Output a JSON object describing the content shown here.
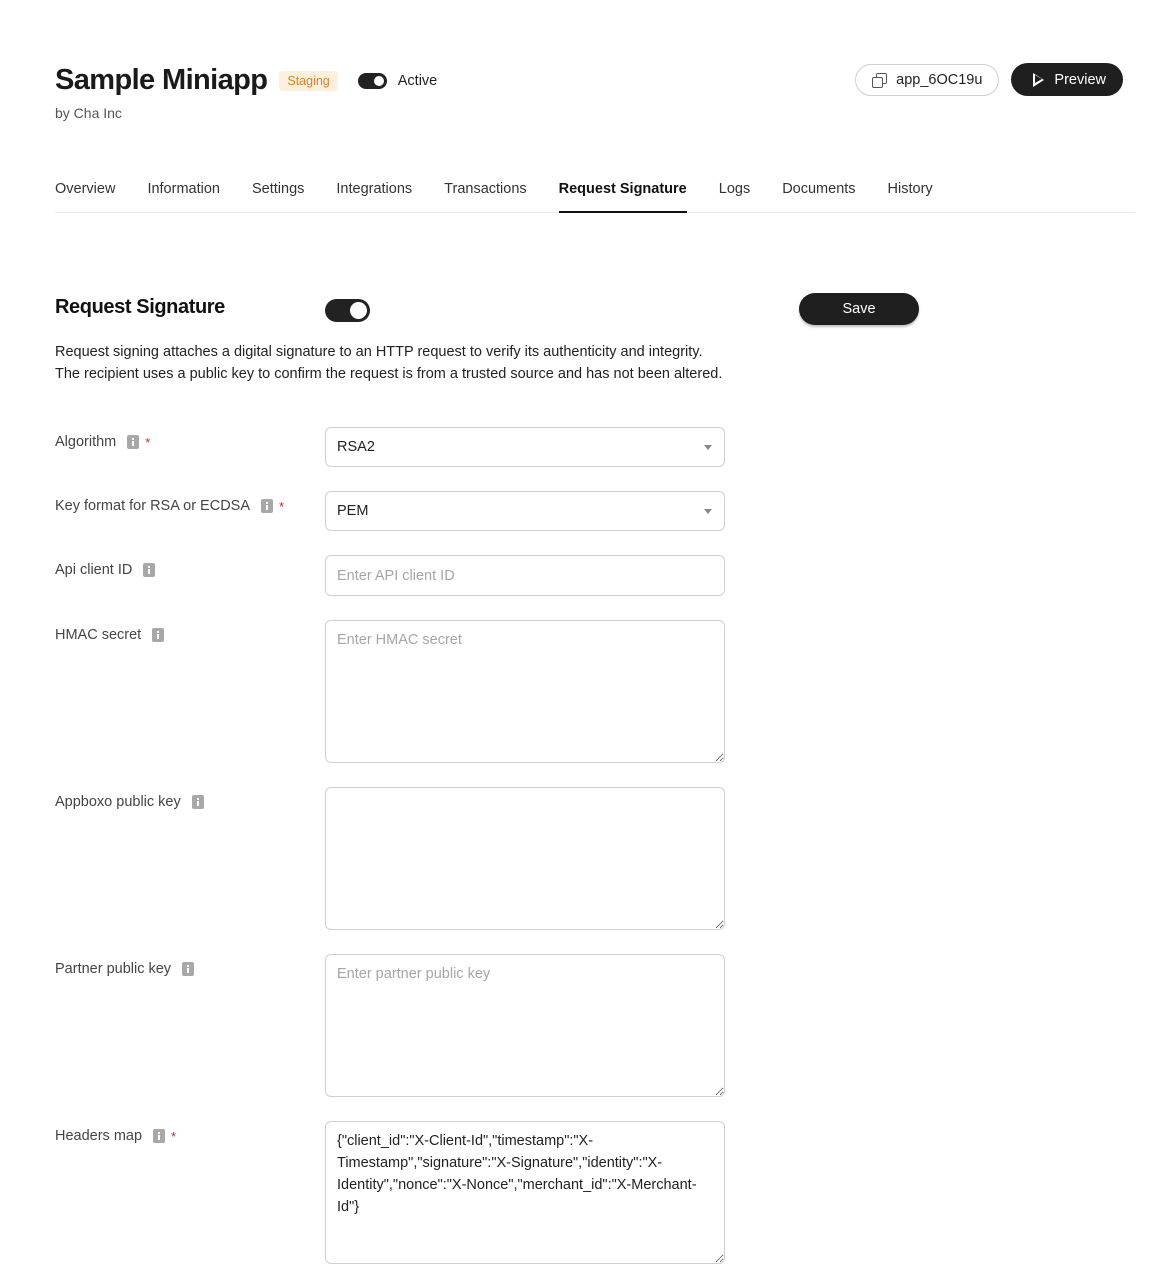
{
  "app": {
    "title": "Sample Miniapp",
    "environment_badge": "Staging",
    "active_label": "Active",
    "active_enabled": true,
    "developer": "by Cha Inc",
    "app_id": "app_6OC19u",
    "preview_label": "Preview"
  },
  "tabs": [
    {
      "label": "Overview",
      "active": false
    },
    {
      "label": "Information",
      "active": false
    },
    {
      "label": "Settings",
      "active": false
    },
    {
      "label": "Integrations",
      "active": false
    },
    {
      "label": "Transactions",
      "active": false
    },
    {
      "label": "Request Signature",
      "active": true
    },
    {
      "label": "Logs",
      "active": false
    },
    {
      "label": "Documents",
      "active": false
    },
    {
      "label": "History",
      "active": false
    }
  ],
  "section": {
    "title": "Request Signature",
    "enabled": true,
    "save_label": "Save",
    "description": "Request signing attaches a digital signature to an HTTP request to verify its authenticity and integrity. The recipient uses a public key to confirm the request is from a trusted source and has not been altered."
  },
  "fields": {
    "algorithm": {
      "label": "Algorithm",
      "required": "*",
      "value": "RSA2"
    },
    "key_format": {
      "label": "Key format for RSA or ECDSA",
      "required": "*",
      "value": "PEM"
    },
    "api_client_id": {
      "label": "Api client ID",
      "value": "",
      "placeholder": "Enter API client ID"
    },
    "hmac_secret": {
      "label": "HMAC secret",
      "value": "",
      "placeholder": "Enter HMAC secret"
    },
    "appboxo_public_key": {
      "label": "Appboxo public key",
      "value": "",
      "placeholder": ""
    },
    "partner_public_key": {
      "label": "Partner public key",
      "value": "",
      "placeholder": "Enter partner public key"
    },
    "headers_map": {
      "label": "Headers map",
      "required": "*",
      "value": "{\"client_id\":\"X-Client-Id\",\"timestamp\":\"X-Timestamp\",\"signature\":\"X-Signature\",\"identity\":\"X-Identity\",\"nonce\":\"X-Nonce\",\"merchant_id\":\"X-Merchant-Id\"}"
    }
  },
  "colors": {
    "primary_dark": "#1f1f1f",
    "badge_background": "#fdf0dd",
    "badge_text": "#d9822b",
    "required": "#c62828"
  }
}
